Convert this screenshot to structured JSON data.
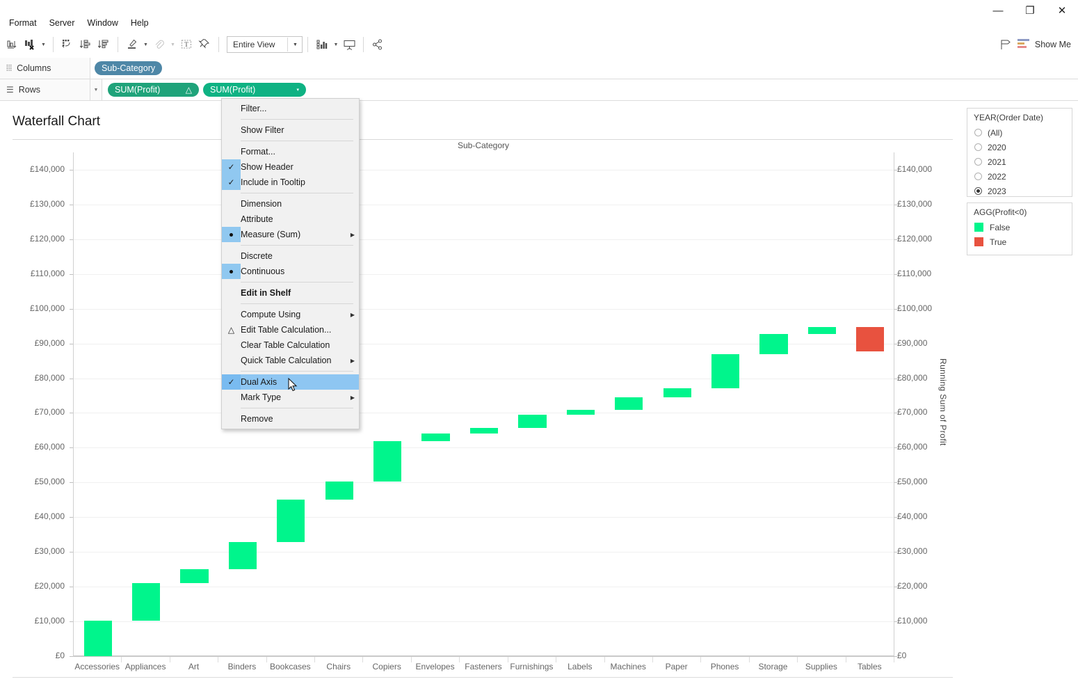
{
  "window": {
    "controls": {
      "minimize": "—",
      "maximize": "❐",
      "close": "✕"
    }
  },
  "menubar": {
    "items": [
      "Format",
      "Server",
      "Window",
      "Help"
    ]
  },
  "toolbar": {
    "fit_label": "Entire View",
    "show_me_label": "Show Me",
    "icons": [
      "swap-rows-columns-icon",
      "clear-sheet-icon",
      "sort-ascending-icon",
      "sort-descending-icon",
      "highlight-icon",
      "attachment-icon",
      "text-label-icon",
      "pin-icon",
      "show-cards-icon",
      "presentation-mode-icon",
      "share-icon",
      "tooltip-icon"
    ]
  },
  "shelves": {
    "columns": {
      "label": "Columns",
      "pills": [
        {
          "text": "Sub-Category",
          "type": "dimension"
        }
      ]
    },
    "rows": {
      "label": "Rows",
      "pills": [
        {
          "text": "SUM(Profit)",
          "badge": "△",
          "type": "measure"
        },
        {
          "text": "SUM(Profit)",
          "badge": "▾",
          "type": "measure-active"
        }
      ]
    }
  },
  "context_menu": {
    "items": [
      {
        "label": "Filter...",
        "mark": "none",
        "submenu": false,
        "highlight": false
      },
      {
        "sep": true
      },
      {
        "label": "Show Filter",
        "mark": "none",
        "submenu": false,
        "highlight": false
      },
      {
        "sep": true
      },
      {
        "label": "Format...",
        "mark": "none",
        "submenu": false,
        "highlight": false
      },
      {
        "label": "Show Header",
        "mark": "check",
        "submenu": false,
        "highlight": false
      },
      {
        "label": "Include in Tooltip",
        "mark": "check",
        "submenu": false,
        "highlight": false
      },
      {
        "sep": true
      },
      {
        "label": "Dimension",
        "mark": "none",
        "submenu": false,
        "highlight": false
      },
      {
        "label": "Attribute",
        "mark": "none",
        "submenu": false,
        "highlight": false
      },
      {
        "label": "Measure (Sum)",
        "mark": "radio",
        "submenu": true,
        "highlight": false
      },
      {
        "sep": true
      },
      {
        "label": "Discrete",
        "mark": "none",
        "submenu": false,
        "highlight": false
      },
      {
        "label": "Continuous",
        "mark": "radio",
        "submenu": false,
        "highlight": false
      },
      {
        "sep": true
      },
      {
        "label": "Edit in Shelf",
        "mark": "none",
        "submenu": false,
        "highlight": false,
        "bold": true
      },
      {
        "sep": true
      },
      {
        "label": "Compute Using",
        "mark": "none",
        "submenu": true,
        "highlight": false
      },
      {
        "label": "Edit Table Calculation...",
        "mark": "delta",
        "submenu": false,
        "highlight": false
      },
      {
        "label": "Clear Table Calculation",
        "mark": "none",
        "submenu": false,
        "highlight": false
      },
      {
        "label": "Quick Table Calculation",
        "mark": "none",
        "submenu": true,
        "highlight": false
      },
      {
        "sep": true
      },
      {
        "label": "Dual Axis",
        "mark": "check",
        "submenu": false,
        "highlight": true
      },
      {
        "label": "Mark Type",
        "mark": "none",
        "submenu": true,
        "highlight": false
      },
      {
        "sep": true
      },
      {
        "label": "Remove",
        "mark": "none",
        "submenu": false,
        "highlight": false
      }
    ]
  },
  "filters": {
    "year": {
      "title": "YEAR(Order Date)",
      "options": [
        {
          "label": "(All)",
          "selected": false
        },
        {
          "label": "2020",
          "selected": false
        },
        {
          "label": "2021",
          "selected": false
        },
        {
          "label": "2022",
          "selected": false
        },
        {
          "label": "2023",
          "selected": true
        }
      ]
    },
    "legend": {
      "title": "AGG(Profit<0)",
      "entries": [
        {
          "label": "False",
          "color": "#00F58C"
        },
        {
          "label": "True",
          "color": "#E8523F"
        }
      ]
    }
  },
  "chart_data": {
    "type": "bar",
    "title": "Waterfall Chart",
    "xlabel": "Sub-Category",
    "ylabel": "Running Sum of Profit",
    "ylim": [
      0,
      145000
    ],
    "ytick_step": 10000,
    "ytick_labels": [
      "£0",
      "£10,000",
      "£20,000",
      "£30,000",
      "£40,000",
      "£50,000",
      "£60,000",
      "£70,000",
      "£80,000",
      "£90,000",
      "£100,000",
      "£110,000",
      "£120,000",
      "£130,000",
      "£140,000"
    ],
    "currency": "£",
    "grid": true,
    "legend_position": "right",
    "categories": [
      "Accessories",
      "Appliances",
      "Art",
      "Binders",
      "Bookcases",
      "Chairs",
      "Copiers",
      "Envelopes",
      "Fasteners",
      "Furnishings",
      "Labels",
      "Machines",
      "Paper",
      "Phones",
      "Storage",
      "Supplies",
      "Tables"
    ],
    "values": [
      10200,
      10800,
      4000,
      7900,
      12200,
      5100,
      11600,
      2200,
      1700,
      3700,
      1500,
      3600,
      2600,
      9900,
      5800,
      2000,
      -7000
    ],
    "running_start": [
      0,
      10200,
      21000,
      25000,
      32900,
      45100,
      50200,
      61800,
      64000,
      65700,
      69400,
      70900,
      74500,
      77100,
      87000,
      92800,
      94800
    ],
    "running_end": [
      10200,
      21000,
      25000,
      32900,
      45100,
      50200,
      61800,
      64000,
      65700,
      69400,
      70900,
      74500,
      77100,
      87000,
      92800,
      94800,
      87800
    ],
    "bar_colors": [
      "#00F58C",
      "#00F58C",
      "#00F58C",
      "#00F58C",
      "#00F58C",
      "#00F58C",
      "#00F58C",
      "#00F58C",
      "#00F58C",
      "#00F58C",
      "#00F58C",
      "#00F58C",
      "#00F58C",
      "#00F58C",
      "#00F58C",
      "#00F58C",
      "#E8523F"
    ],
    "series": [
      {
        "name": "False",
        "color": "#00F58C"
      },
      {
        "name": "True",
        "color": "#E8523F"
      }
    ]
  }
}
